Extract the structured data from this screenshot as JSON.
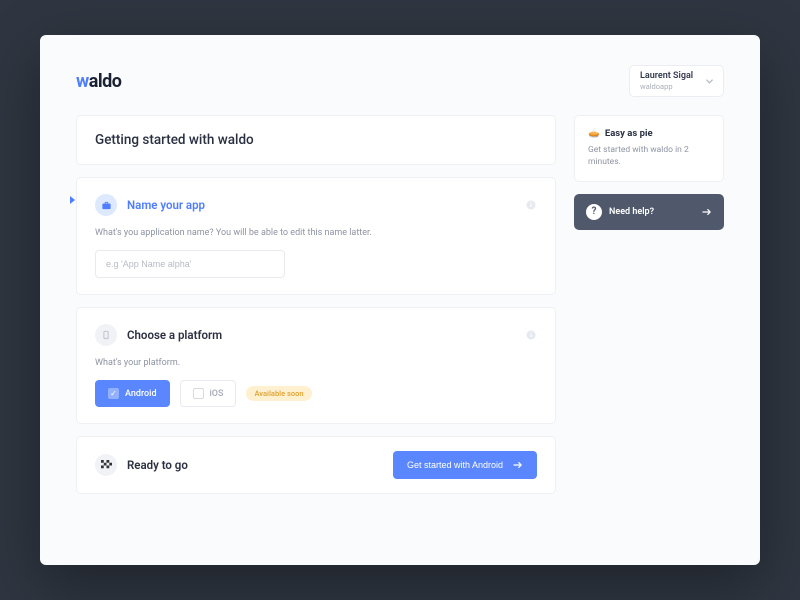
{
  "brand": {
    "prefix": "w",
    "rest": "aldo"
  },
  "user": {
    "name": "Laurent Sigal",
    "org": "waldoapp"
  },
  "page": {
    "title": "Getting started with waldo"
  },
  "step1": {
    "title": "Name your app",
    "desc": "What's you application name? You will be able to edit this name latter.",
    "placeholder": "e.g 'App Name alpha'"
  },
  "step2": {
    "title": "Choose a platform",
    "desc": "What's your platform.",
    "android": "Android",
    "ios": "iOS",
    "soon": "Available soon"
  },
  "step3": {
    "title": "Ready to go",
    "cta": "Get started with Android"
  },
  "side": {
    "easy_title": "Easy as pie",
    "easy_desc": "Get started with waldo in 2 minutes.",
    "help": "Need help?"
  }
}
